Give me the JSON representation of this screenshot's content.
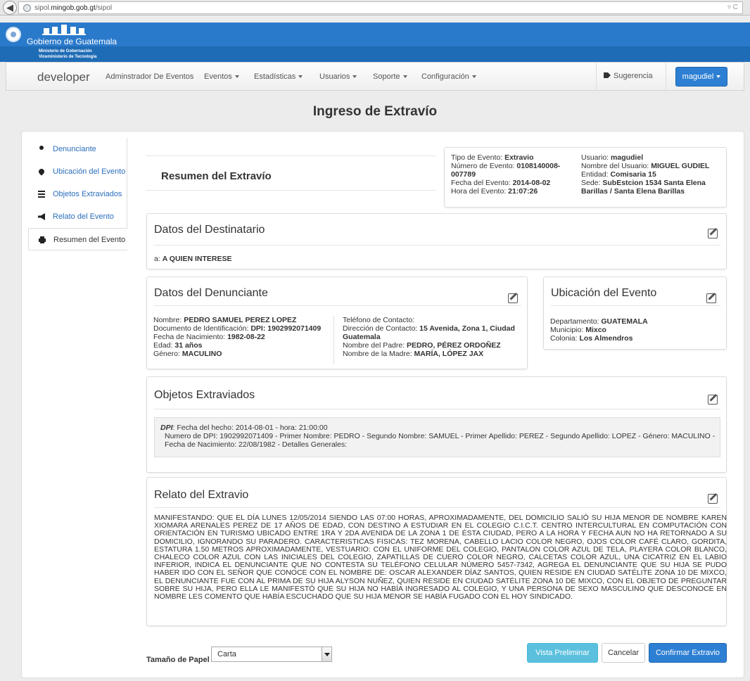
{
  "browser": {
    "url_prefix": "sipol.",
    "url_domain": "mingob.gob.gt",
    "url_suffix": "/sipol",
    "right_controls": "▿ C"
  },
  "banner": {
    "title": "Gobierno de Guatemala",
    "sub1": "Ministerio de Gobernación",
    "sub2": "Viceministerio de Tecnología"
  },
  "navbar": {
    "brand": "developer",
    "items": [
      "Adminstrador De Eventos",
      "Eventos",
      "Estadísticas",
      "Usuarios",
      "Soporte",
      "Configuración"
    ],
    "suggest": "Sugerencia",
    "user": "magudiel"
  },
  "page_title": "Ingreso de Extravío",
  "sidebar": {
    "items": [
      "Denunciante",
      "Ubicación del Evento",
      "Objetos Extraviados",
      "Relato del Evento",
      "Resumen del Evento"
    ],
    "active_index": 4
  },
  "summary": {
    "title": "Resumen del Extravío",
    "left": [
      {
        "k": "Tipo de Evento: ",
        "v": "Extravio"
      },
      {
        "k": "Número de Evento: ",
        "v": "0108140008-007789"
      },
      {
        "k": "Fecha del Evento: ",
        "v": "2014-08-02"
      },
      {
        "k": "Hora del Evento: ",
        "v": "21:07:26"
      }
    ],
    "right": [
      {
        "k": "Usuario: ",
        "v": "magudiel"
      },
      {
        "k": "Nombre del Usuario: ",
        "v": "MIGUEL GUDIEL"
      },
      {
        "k": "Entidad: ",
        "v": "Comisaria 15"
      },
      {
        "k": "Sede: ",
        "v": "SubEstcion 1534 Santa Elena Barillas / Santa Elena Barillas"
      }
    ]
  },
  "destinatario": {
    "title": "Datos del Destinatario",
    "label": "a: ",
    "value": "A QUIEN INTERESE"
  },
  "denunciante": {
    "title": "Datos del Denunciante",
    "left": [
      {
        "k": "Nombre: ",
        "v": "PEDRO SAMUEL PEREZ LOPEZ"
      },
      {
        "k": "Documento de Identificación: ",
        "v": "DPI: 1902992071409"
      },
      {
        "k": "Fecha de Nacimiento: ",
        "v": "1982-08-22"
      },
      {
        "k": "Edad: ",
        "v": "31 años"
      },
      {
        "k": "Género: ",
        "v": "MACULINO"
      }
    ],
    "right": [
      {
        "k": "Teléfono de Contacto: ",
        "v": ""
      },
      {
        "k": "Dirección de Contacto: ",
        "v": "15 Avenida, Zona 1, Ciudad Guatemala"
      },
      {
        "k": "Nombre del Padre: ",
        "v": "PEDRO, PÉREZ ORDOÑEZ"
      },
      {
        "k": "Nombre de la Madre: ",
        "v": "MARÍA, LÓPEZ JAX"
      }
    ]
  },
  "ubicacion": {
    "title": "Ubicación del Evento",
    "rows": [
      {
        "k": "Departamento: ",
        "v": "GUATEMALA"
      },
      {
        "k": "Municipio: ",
        "v": "Mixco"
      },
      {
        "k": "Colonia: ",
        "v": "Los Almendros"
      }
    ]
  },
  "objetos": {
    "title": "Objetos Extraviados",
    "type": "DPI",
    "line1": ": Fecha del hecho: 2014-08-01 - hora: 21:00:00",
    "line2": "Numero de DPI: 1902992071409 - Primer Nombre: PEDRO - Segundo Nombre: SAMUEL - Primer Apellido: PEREZ - Segundo Apellido: LOPEZ - Género: MACULINO -",
    "line3": "Fecha de Nacimiento: 22/08/1982 - Detalles Generales:"
  },
  "relato": {
    "title": "Relato del Extravio",
    "text": "MANIFESTANDO: QUE EL DÍA LUNES 12/05/2014 SIENDO LAS 07:00 HORAS, APROXIMADAMENTE, DEL DOMICILIO SALIÓ SU HIJA MENOR DE NOMBRE KAREN XIOMARA ARENALES PEREZ DE 17 AÑOS DE EDAD, CON DESTINO A ESTUDIAR EN EL COLEGIO C.I.C.T. CENTRO INTERCULTURAL EN COMPUTACIÓN CON ORIENTACIÓN EN TURISMO UBICADO ENTRE 1RA Y 2DA AVENIDA DE LA ZONA 1 DE ÉSTA CIUDAD, PERO A LA HORA Y FECHA AUN NO HA RETORNADO A SU DOMICILIO, IGNORANDO SU PARADERO.  CARACTERISTICAS FISICAS: TEZ MORENA, CABELLO LACIO COLOR NEGRO, OJOS COLOR CAFÉ CLARO, GORDITA, ESTATURA 1.50 METROS APROXIMADAMENTE, VESTUARIO: CON EL UNIFORME DEL COLEGIO, PANTALON COLOR AZUL DE TELA, PLAYERA COLOR BLANCO, CHALECO COLOR AZUL CON LAS INICIALES DEL COLEGIO, ZAPATILLAS DE CUERO COLOR NEGRO, CALCETAS COLOR AZUL, UNA CICATRIZ EN EL LABIO INFERIOR, INDICA EL DENUNCIANTE QUE NO CONTESTA SU TELÉFONO CELULAR NÚMERO 5457-7342, AGREGA EL DENUNCIANTE QUE SU HIJA SE PUDO HABER IDO CON EL SEÑOR QUE CONOCE CON EL NOMBRE DE: OSCAR ALEXANDER DÍAZ SANTOS, QUIEN RESIDE EN CIUDAD SATÉLITE ZONA 10 DE MIXCO, EL DENUNCIANTE FUE CON AL PRIMA DE SU HIJA ALYSON NUÑEZ, QUIEN RESIDE EN CIUDAD SATÉLITE ZONA 10 DE MIXCO, CON EL OBJETO DE PREGUNTAR SOBRE SU HIJA, PERO ELLA LE MANIFESTÓ QUE SU HIJA NO HABÍA INGRESADO AL COLEGIO, Y UNA PERSONA DE SEXO MASCULINO QUE DESCONOCE EN NOMBRE LES COMENTO QUE HABÍA ESCUCHADO QUE SU HIJA MENOR SE HABÍA FUGADO CON EL HOY SINDICADO."
  },
  "footer": {
    "paper_label": "Tamaño de Papel",
    "paper_value": "Carta",
    "preview": "Vista Preliminar",
    "cancel": "Cancelar",
    "confirm": "Confirmar Extravio"
  },
  "colors": {
    "primary": "#2d7fd3",
    "info": "#5bc0de",
    "banner": "#1f6cb6"
  }
}
